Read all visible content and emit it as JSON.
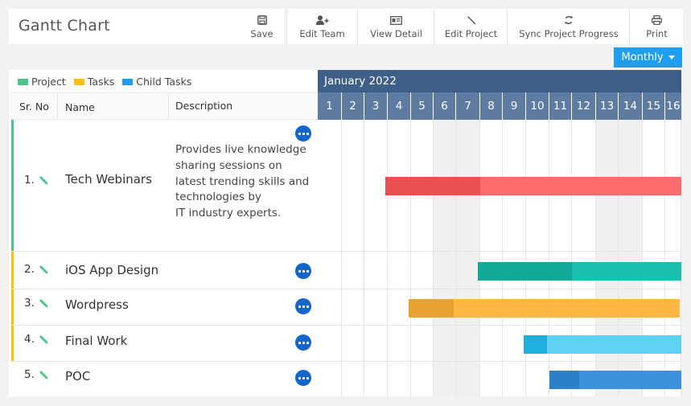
{
  "header": {
    "title": "Gantt Chart",
    "toolbar": [
      {
        "label": "Save",
        "icon": "save-icon"
      },
      {
        "label": "Edit Team",
        "icon": "user-plus-icon"
      },
      {
        "label": "View Detail",
        "icon": "id-card-icon"
      },
      {
        "label": "Edit Project",
        "icon": "pencil-icon"
      },
      {
        "label": "Sync Project Progress",
        "icon": "refresh-icon"
      },
      {
        "label": "Print",
        "icon": "print-icon"
      }
    ]
  },
  "view_select": {
    "label": "Monthly"
  },
  "legend": [
    {
      "label": "Project",
      "color": "#4cc38a"
    },
    {
      "label": "Tasks",
      "color": "#fbbf0f"
    },
    {
      "label": "Child Tasks",
      "color": "#1e9ef0"
    }
  ],
  "table": {
    "columns": [
      "Sr. No",
      "Name",
      "Description"
    ],
    "rows": [
      {
        "sr": "1.",
        "name": "Tech Webinars",
        "type": "Project",
        "description": [
          "Provides live knowledge",
          "sharing sessions on",
          "latest trending skills and",
          "technologies by",
          "IT industry experts."
        ]
      },
      {
        "sr": "2.",
        "name": "iOS App Design",
        "type": "Tasks",
        "description": []
      },
      {
        "sr": "3.",
        "name": "Wordpress",
        "type": "Tasks",
        "description": []
      },
      {
        "sr": "4.",
        "name": "Final Work",
        "type": "Tasks",
        "description": []
      },
      {
        "sr": "5.",
        "name": "POC",
        "type": "Child Tasks",
        "description": []
      }
    ]
  },
  "timeline": {
    "month": "January 2022",
    "days": [
      "1",
      "2",
      "3",
      "4",
      "5",
      "6",
      "7",
      "8",
      "9",
      "10",
      "11",
      "12",
      "13",
      "14",
      "15",
      "16"
    ],
    "weekends": [
      "6",
      "7",
      "13",
      "14"
    ]
  },
  "chart_data": {
    "type": "gantt",
    "title": "January 2022",
    "x_unit": "day",
    "visible_range": [
      1,
      16
    ],
    "series": [
      {
        "name": "Tech Webinars",
        "start_day": 3.9,
        "end_day": "beyond 16",
        "progress_until_day": 8.0,
        "color": "#ff6b6b",
        "progress_color": "#eb5050"
      },
      {
        "name": "iOS App Design",
        "start_day": 7.9,
        "end_day": "beyond 16",
        "progress_until_day": 12.0,
        "color": "#1abfae",
        "progress_color": "#12a99a"
      },
      {
        "name": "Wordpress",
        "start_day": 4.9,
        "end_day": 16.9,
        "progress_until_day": 6.9,
        "color": "#fdb741",
        "progress_color": "#e8a230"
      },
      {
        "name": "Final Work",
        "start_day": 9.9,
        "end_day": "beyond 16",
        "progress_until_day": 10.9,
        "color": "#5fd1f5",
        "progress_color": "#1fb0de"
      },
      {
        "name": "POC",
        "start_day": 11.0,
        "end_day": "beyond 16",
        "progress_until_day": 12.3,
        "color": "#3d90dc",
        "progress_color": "#2b80c8"
      }
    ]
  }
}
